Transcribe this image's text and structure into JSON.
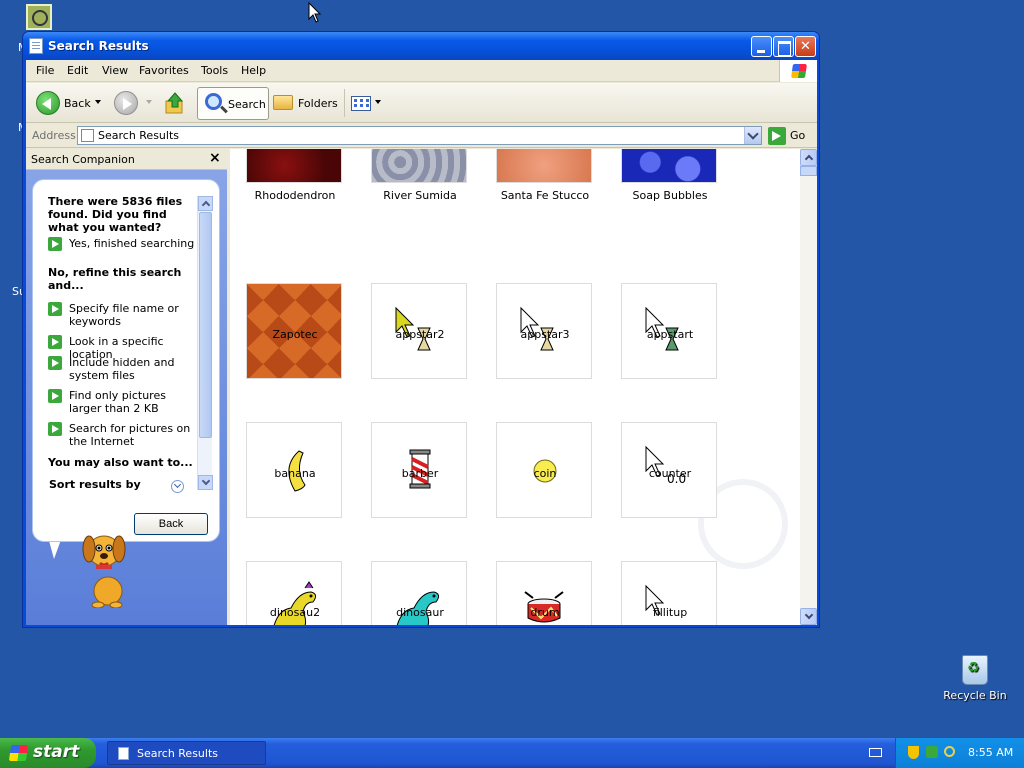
{
  "desktop": {
    "fragments": [
      "M",
      "M",
      "Su"
    ],
    "recycle_bin_label": "Recycle Bin"
  },
  "window": {
    "title": "Search Results",
    "menu": [
      "File",
      "Edit",
      "View",
      "Favorites",
      "Tools",
      "Help"
    ],
    "toolbar": {
      "back_label": "Back",
      "search_label": "Search",
      "folders_label": "Folders"
    },
    "address": {
      "label": "Address",
      "value": "Search Results",
      "go_label": "Go"
    }
  },
  "companion": {
    "title": "Search Companion",
    "close_glyph": "×",
    "question": "There were 5836 files found. Did you find what you wanted?",
    "yes_option": "Yes, finished searching",
    "refine_heading": "No, refine this search and...",
    "refine_options": [
      "Specify file name or keywords",
      "Look in a specific location",
      "Include hidden and system files",
      "Find only pictures larger than 2 KB",
      "Search for pictures on the Internet"
    ],
    "also_heading": "You may also want to...",
    "sort_label": "Sort results by",
    "back_button": "Back"
  },
  "results": {
    "items": [
      {
        "name": "Rhododendron",
        "kind": "wallpaper-thumbnail"
      },
      {
        "name": "River Sumida",
        "kind": "wallpaper-thumbnail"
      },
      {
        "name": "Santa Fe Stucco",
        "kind": "wallpaper-thumbnail"
      },
      {
        "name": "Soap Bubbles",
        "kind": "wallpaper-thumbnail"
      },
      {
        "name": "Zapotec",
        "kind": "wallpaper-thumbnail"
      },
      {
        "name": "appstar2",
        "kind": "cursor-hourglass-icon"
      },
      {
        "name": "appstar3",
        "kind": "cursor-hourglass-icon"
      },
      {
        "name": "appstart",
        "kind": "cursor-hourglass-icon"
      },
      {
        "name": "banana",
        "kind": "banana-icon"
      },
      {
        "name": "barber",
        "kind": "barber-pole-icon"
      },
      {
        "name": "coin",
        "kind": "coin-icon"
      },
      {
        "name": "counter",
        "kind": "cursor-counter-icon",
        "overlay": "0.0"
      },
      {
        "name": "dinosau2",
        "kind": "dinosaur-yellow-icon"
      },
      {
        "name": "dinosaur",
        "kind": "dinosaur-cyan-icon"
      },
      {
        "name": "drum",
        "kind": "drum-icon"
      },
      {
        "name": "fillitup",
        "kind": "cursor-arrow-icon"
      }
    ]
  },
  "taskbar": {
    "start_label": "start",
    "task_label": "Search Results",
    "clock": "8:55 AM"
  },
  "colors": {
    "desktop": "#2356a6",
    "titlebar": "#0a5ae8",
    "taskbar": "#245edc",
    "start": "#2f9a2f",
    "tray": "#0c80d8"
  }
}
